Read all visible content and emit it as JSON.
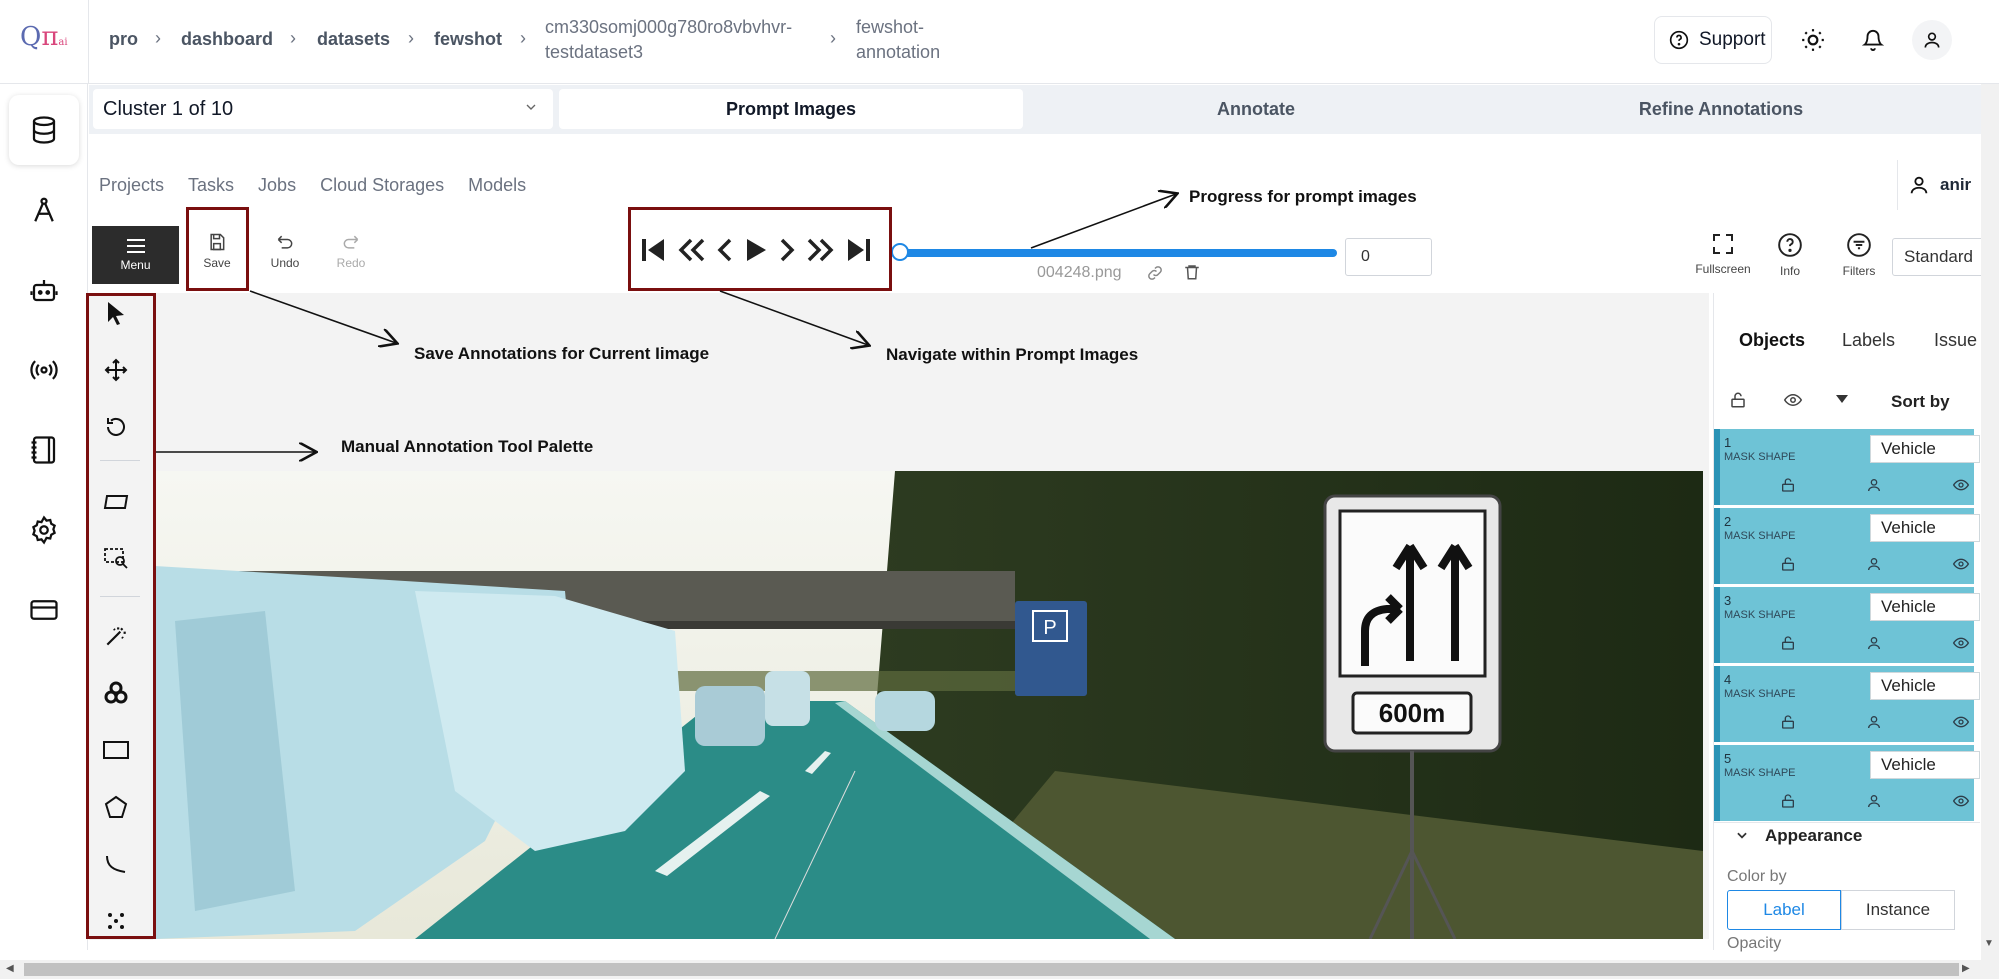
{
  "logo": {
    "main": "Q",
    "pi": "π",
    "sub": "ai"
  },
  "breadcrumb": [
    {
      "label": "pro"
    },
    {
      "label": "dashboard"
    },
    {
      "label": "datasets"
    },
    {
      "label": "fewshot"
    },
    {
      "label_line1": "cm330somj000g780ro8vbvhvr-",
      "label_line2": "testdataset3"
    },
    {
      "label_line1": "fewshot-",
      "label_line2": "annotation"
    }
  ],
  "header": {
    "support_label": "Support"
  },
  "cluster": {
    "label": "Cluster 1 of 10"
  },
  "tabs": [
    {
      "label": "Prompt Images",
      "active": true
    },
    {
      "label": "Annotate",
      "active": false
    },
    {
      "label": "Refine Annotations",
      "active": false
    }
  ],
  "cvat_nav": [
    "Projects",
    "Tasks",
    "Jobs",
    "Cloud Storages",
    "Models"
  ],
  "user": {
    "name": "anir"
  },
  "toolbar": {
    "menu_label": "Menu",
    "save_label": "Save",
    "undo_label": "Undo",
    "redo_label": "Redo",
    "frame_value": "0",
    "filename": "004248.png",
    "fullscreen_label": "Fullscreen",
    "info_label": "Info",
    "filters_label": "Filters",
    "workspace_value": "Standard"
  },
  "player": {
    "progress_fraction": 0.0
  },
  "annotations": {
    "progress": "Progress for prompt images",
    "save": "Save Annotations for Current Iimage",
    "navigate": "Navigate within Prompt Images",
    "palette": "Manual Annotation Tool Palette"
  },
  "image": {
    "sign_distance": "600m",
    "parking_sign": "P"
  },
  "sidebar": {
    "tabs": [
      "Objects",
      "Labels",
      "Issue"
    ],
    "sort_label": "Sort by",
    "objects": [
      {
        "id": "1",
        "type": "MASK SHAPE",
        "label": "Vehicle"
      },
      {
        "id": "2",
        "type": "MASK SHAPE",
        "label": "Vehicle"
      },
      {
        "id": "3",
        "type": "MASK SHAPE",
        "label": "Vehicle"
      },
      {
        "id": "4",
        "type": "MASK SHAPE",
        "label": "Vehicle"
      },
      {
        "id": "5",
        "type": "MASK SHAPE",
        "label": "Vehicle"
      }
    ],
    "appearance_label": "Appearance",
    "color_by_label": "Color by",
    "color_options": [
      "Label",
      "Instance"
    ],
    "opacity_label": "Opacity"
  },
  "colors": {
    "accent": "#1e88e5",
    "object_row": "#6ec3d6",
    "highlight_box": "#7a0f0f"
  }
}
